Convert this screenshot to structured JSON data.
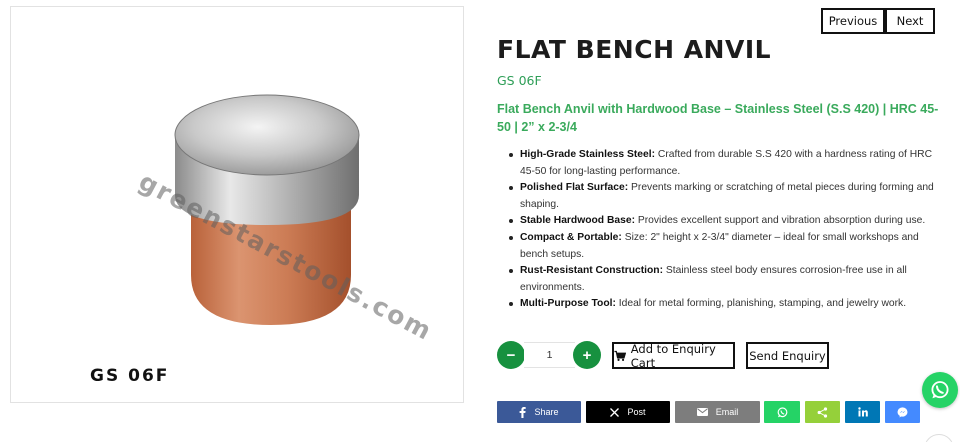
{
  "gallery": {
    "thumb_caption": "GS 06F",
    "watermark": "greenstarstools.com",
    "image_caption": "GS 06F"
  },
  "nav": {
    "previous_label": "Previous",
    "next_label": "Next"
  },
  "product": {
    "title": "FLAT BENCH ANVIL",
    "sku": "GS 06F",
    "subtitle": "Flat Bench Anvil with Hardwood Base – Stainless Steel (S.S 420) | HRC 45-50 | 2” x 2-3/4",
    "features": [
      {
        "label": "High-Grade Stainless Steel:",
        "text": " Crafted from durable S.S 420 with a hardness rating of HRC 45-50 for long-lasting performance."
      },
      {
        "label": "Polished Flat Surface:",
        "text": " Prevents marking or scratching of metal pieces during forming and shaping."
      },
      {
        "label": "Stable Hardwood Base:",
        "text": " Provides excellent support and vibration absorption during use."
      },
      {
        "label": "Compact & Portable:",
        "text": " Size: 2\" height x 2-3/4\" diameter – ideal for small workshops and bench setups."
      },
      {
        "label": "Rust-Resistant Construction:",
        "text": " Stainless steel body ensures corrosion-free use in all environments."
      },
      {
        "label": "Multi-Purpose Tool:",
        "text": " Ideal for metal forming, planishing, stamping, and jewelry work."
      }
    ]
  },
  "cart": {
    "minus_label": "−",
    "plus_label": "+",
    "quantity": "1",
    "add_label": "Add to Enquiry Cart",
    "send_label": "Send Enquiry"
  },
  "share": {
    "facebook_label": "Share",
    "x_label": "Post",
    "email_label": "Email"
  },
  "icons": {
    "facebook": "facebook-icon",
    "x": "x-icon",
    "email": "email-icon",
    "whatsapp": "whatsapp-icon",
    "sharethis": "share-icon",
    "linkedin": "linkedin-icon",
    "messenger": "messenger-icon",
    "cart": "cart-icon"
  },
  "colors": {
    "accent_green": "#17913f",
    "subtitle_green": "#3aaa5c",
    "facebook": "#3b5998",
    "x": "#000000",
    "email": "#7d7d7d",
    "whatsapp": "#25d366",
    "sharethis": "#95d03a",
    "linkedin": "#0077b5",
    "messenger": "#448aff"
  }
}
